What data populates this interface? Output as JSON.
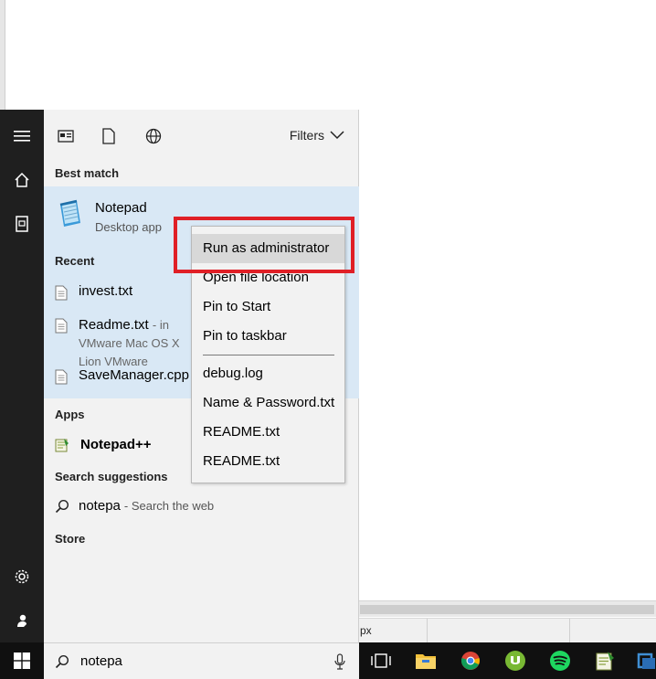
{
  "start_menu": {
    "filters_label": "Filters",
    "best_match_heading": "Best match",
    "best_match": {
      "title": "Notepad",
      "subtitle": "Desktop app"
    },
    "recent_heading": "Recent",
    "recent": [
      {
        "name": "invest.txt",
        "location": ""
      },
      {
        "name": "Readme.txt",
        "location": "- in VMware Mac OS X Lion VMware"
      },
      {
        "name": "SaveManager.cpp",
        "location": ""
      }
    ],
    "apps_heading": "Apps",
    "apps": [
      {
        "name": "Notepad++"
      }
    ],
    "suggestions_heading": "Search suggestions",
    "suggestion": {
      "query": "notepa",
      "hint": "- Search the web"
    },
    "store_heading": "Store"
  },
  "context_menu": {
    "items": [
      "Run as administrator",
      "Open file location",
      "Pin to Start",
      "Pin to taskbar",
      "debug.log",
      "Name & Password.txt",
      "README.txt",
      "README.txt"
    ],
    "highlighted": "Run as administrator"
  },
  "taskbar": {
    "search_value": "notepa",
    "apps": [
      "task-view",
      "file-explorer",
      "chrome",
      "utorrent",
      "spotify",
      "notepad-plus-plus",
      "vmware"
    ]
  },
  "background_window": {
    "status_fragment": "px"
  },
  "colors": {
    "start_rail": "#1f1f1f",
    "panel": "#f2f2f2",
    "highlight": "#d9e8f5",
    "callout": "#e01f26",
    "taskbar": "#101010"
  }
}
